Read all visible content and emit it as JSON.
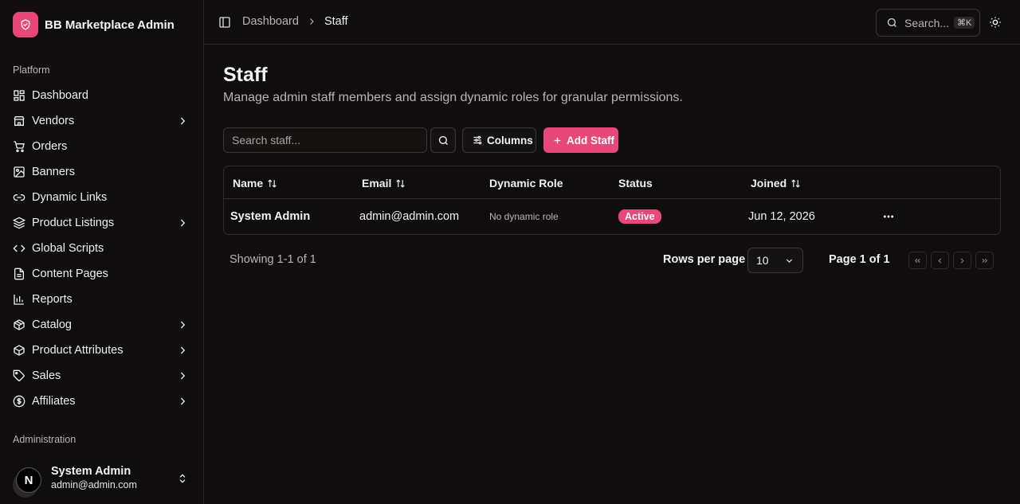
{
  "sidebar": {
    "brand": "BB Marketplace Admin",
    "platform_label": "Platform",
    "admin_label": "Administration",
    "items": [
      {
        "label": "Dashboard",
        "icon": "dashboard-icon",
        "has_children": false
      },
      {
        "label": "Vendors",
        "icon": "store-icon",
        "has_children": true
      },
      {
        "label": "Orders",
        "icon": "cart-icon",
        "has_children": false
      },
      {
        "label": "Banners",
        "icon": "image-icon",
        "has_children": false
      },
      {
        "label": "Dynamic Links",
        "icon": "link-icon",
        "has_children": false
      },
      {
        "label": "Product Listings",
        "icon": "layers-icon",
        "has_children": true
      },
      {
        "label": "Global Scripts",
        "icon": "code-icon",
        "has_children": false
      },
      {
        "label": "Content Pages",
        "icon": "file-icon",
        "has_children": false
      },
      {
        "label": "Reports",
        "icon": "bar-chart-icon",
        "has_children": false
      },
      {
        "label": "Catalog",
        "icon": "package-icon",
        "has_children": true
      },
      {
        "label": "Product Attributes",
        "icon": "box-icon",
        "has_children": true
      },
      {
        "label": "Sales",
        "icon": "tag-icon",
        "has_children": true
      },
      {
        "label": "Affiliates",
        "icon": "dollar-circle-icon",
        "has_children": true
      }
    ],
    "user": {
      "initial": "N",
      "name": "System Admin",
      "email": "admin@admin.com"
    }
  },
  "header": {
    "breadcrumb": {
      "parent": "Dashboard",
      "current": "Staff"
    },
    "search_label": "Search...",
    "search_shortcut": "⌘K"
  },
  "main": {
    "title": "Staff",
    "subtitle": "Manage admin staff members and assign dynamic roles for granular permissions.",
    "search_placeholder": "Search staff...",
    "columns_label": "Columns",
    "add_label": "Add Staff",
    "table": {
      "headers": {
        "name": "Name",
        "email": "Email",
        "role": "Dynamic Role",
        "status": "Status",
        "joined": "Joined"
      },
      "rows": [
        {
          "name": "System Admin",
          "email": "admin@admin.com",
          "role": "No dynamic role",
          "status": "Active",
          "joined": "Jun 12, 2026"
        }
      ]
    },
    "footer": {
      "showing": "Showing 1-1 of 1",
      "rows_per_page_label": "Rows per page",
      "rows_per_page": "10",
      "page_info": "Page 1 of 1"
    }
  },
  "colors": {
    "accent": "#e8477a",
    "background": "#0f0d0d"
  }
}
